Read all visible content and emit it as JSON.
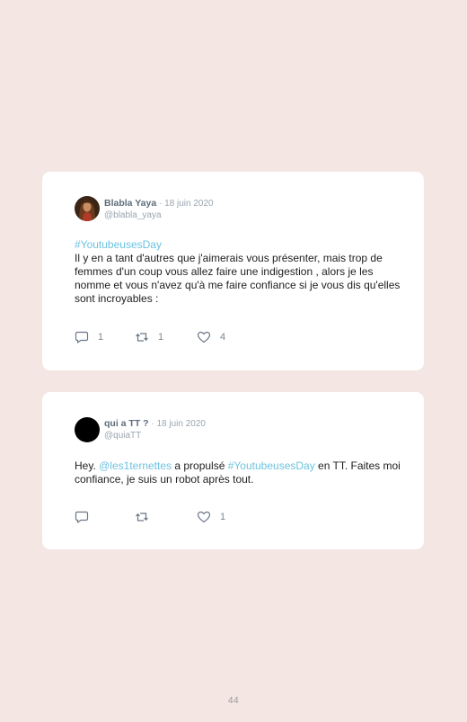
{
  "tweets": [
    {
      "author_name": "Blabla Yaya",
      "separator": "·",
      "date": "18 juin 2020",
      "handle": "@blabla_yaya",
      "hashtag": "#YoutubeusesDay",
      "text": "Il y en a tant d'autres que j'aimerais vous présenter, mais trop de femmes d'un coup vous allez faire une indigestion , alors je les nomme et vous n'avez qu'à me faire confiance si je vous dis qu'elles sont incroyables :",
      "replies": "1",
      "retweets": "1",
      "likes": "4"
    },
    {
      "author_name": "qui a TT ?",
      "separator": "·",
      "date": "18 juin 2020",
      "handle": "@quiaTT",
      "text_before_mention": "Hey. ",
      "mention": "@les1ternettes",
      "text_mid": " a propulsé ",
      "hashtag": "#YoutubeusesDay",
      "text_after": " en TT. Faites moi confiance, je suis un robot après tout.",
      "likes": "1"
    }
  ],
  "page_number": "44",
  "colors": {
    "background": "#f3e6e3",
    "link": "#6cc3df",
    "name": "#5e6d7c",
    "muted": "#9aa4ae"
  },
  "icons": [
    "reply-icon",
    "retweet-icon",
    "like-icon"
  ]
}
